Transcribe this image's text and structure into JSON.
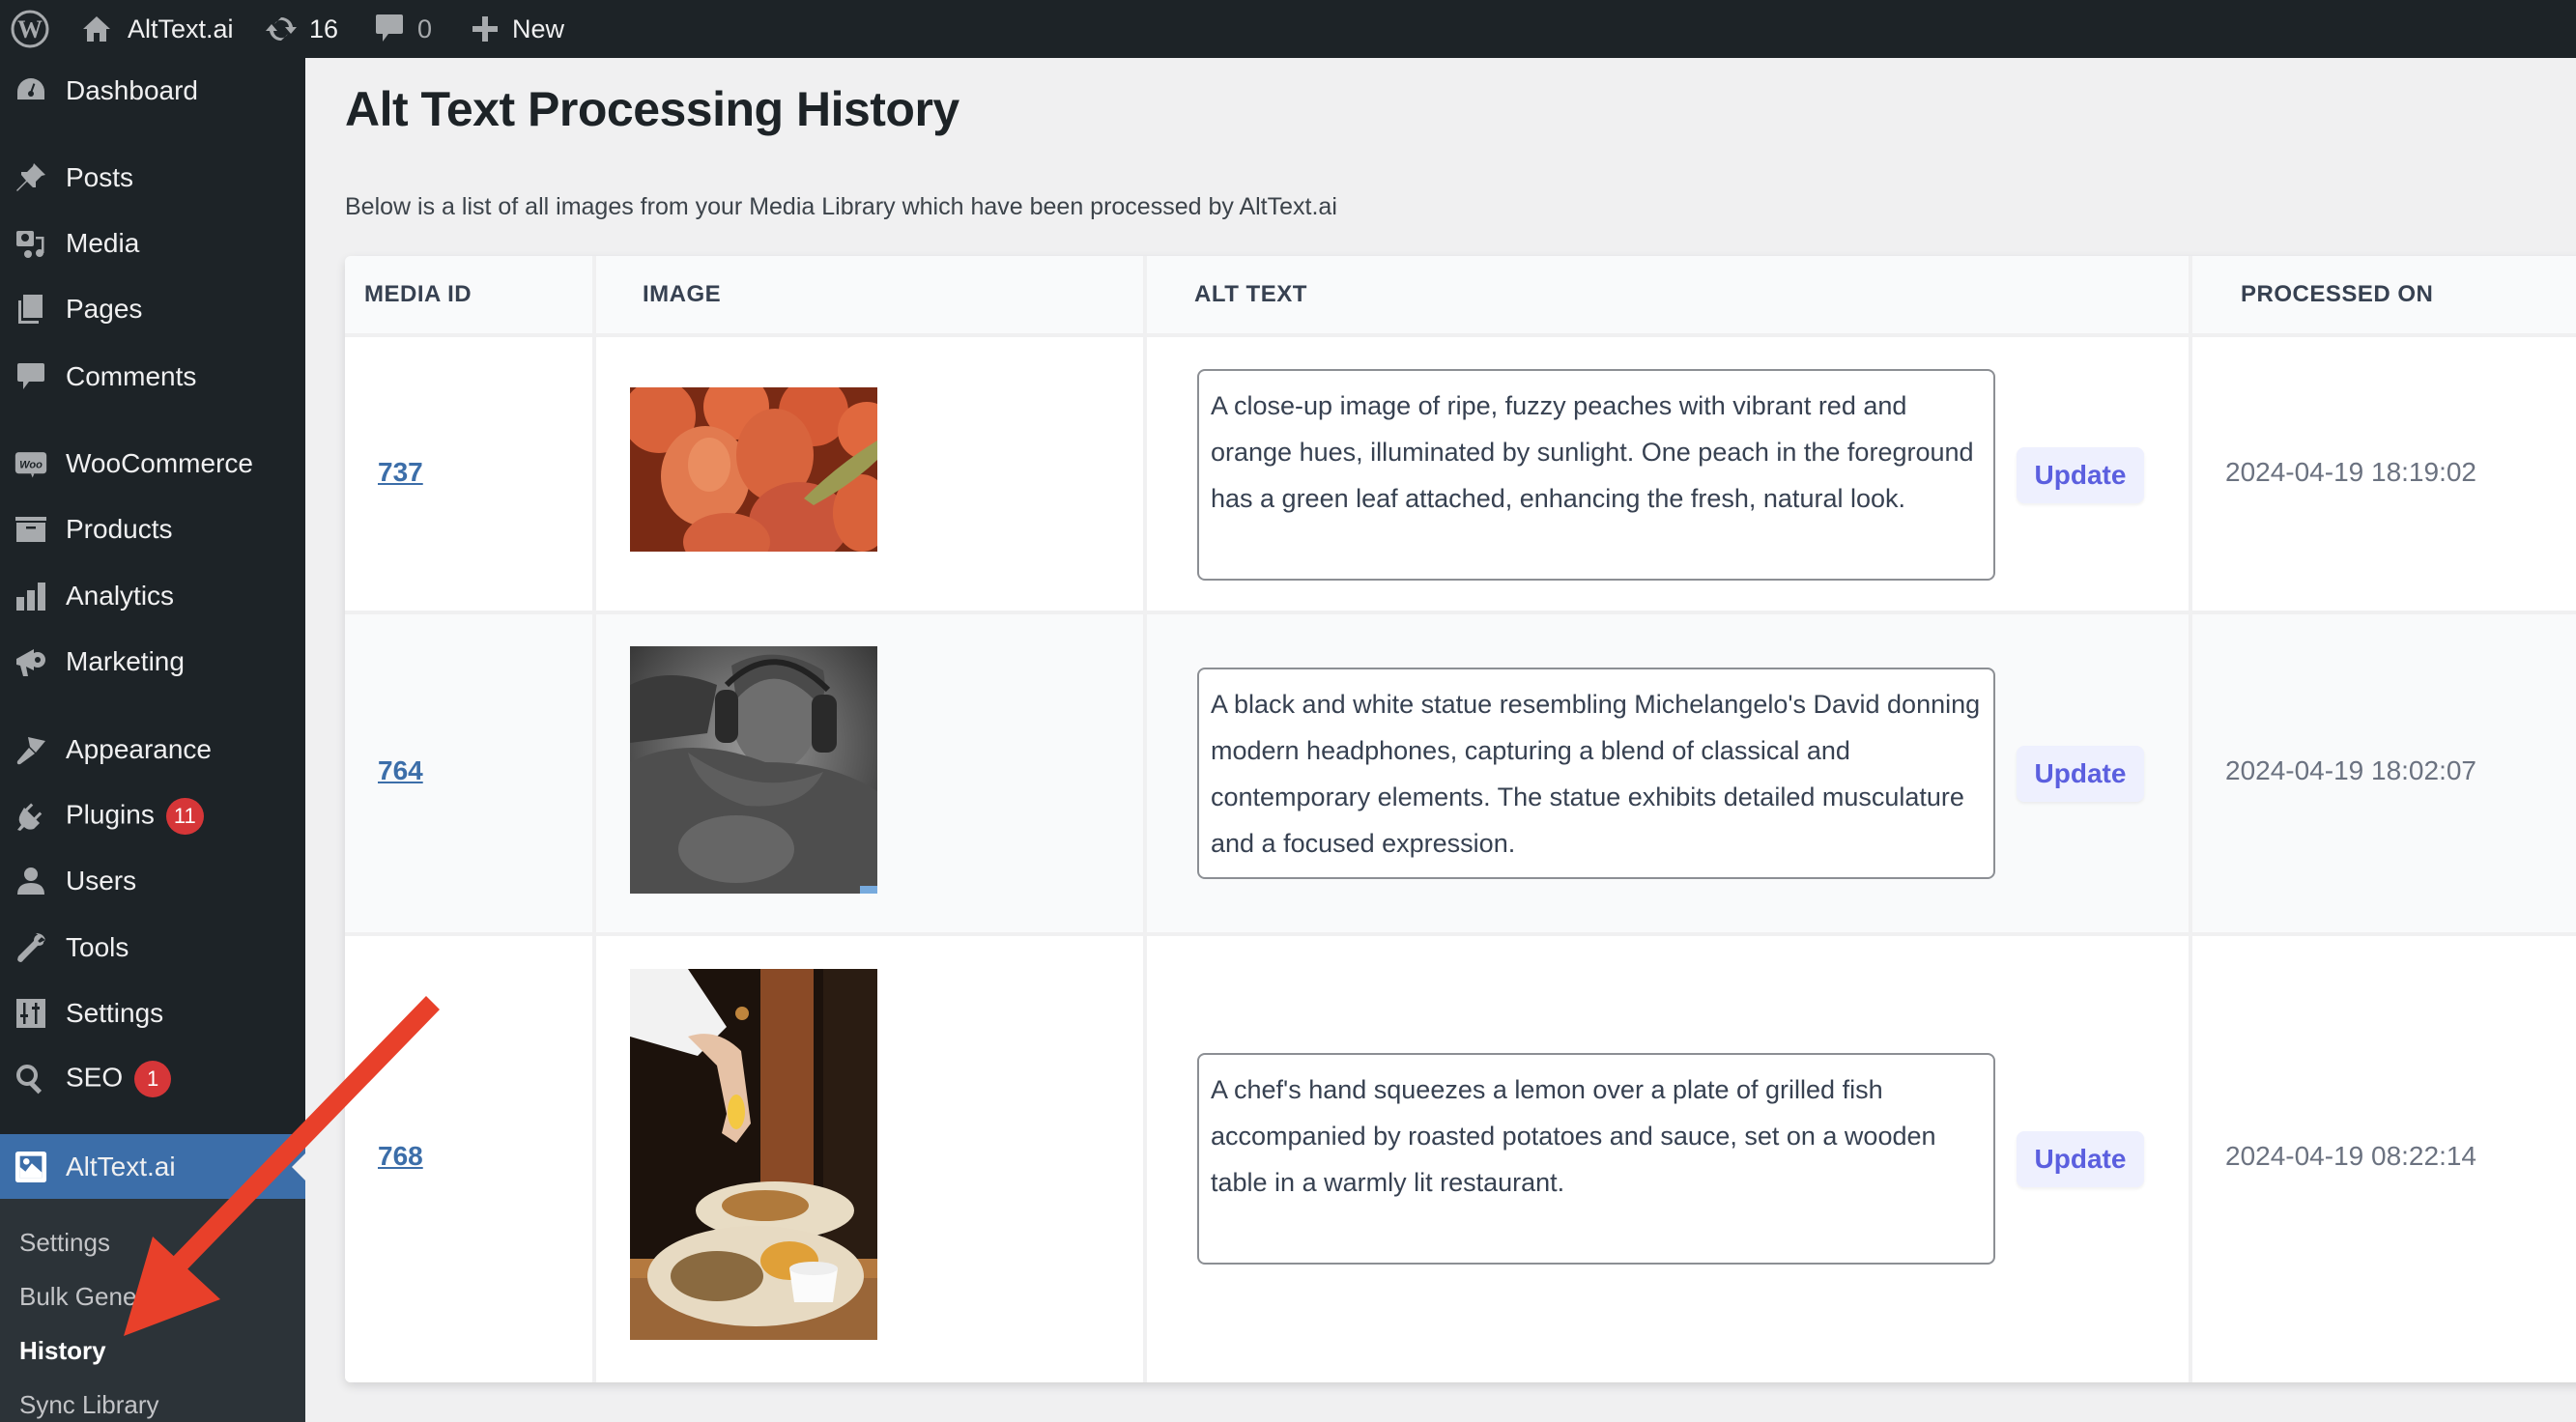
{
  "adminbar": {
    "site_name": "AltText.ai",
    "updates_count": "16",
    "comments_count": "0",
    "new_label": "New"
  },
  "sidebar": {
    "items": [
      {
        "label": "Dashboard",
        "icon": "dashboard-icon"
      },
      {
        "label": "Posts",
        "icon": "pin-icon"
      },
      {
        "label": "Media",
        "icon": "media-icon"
      },
      {
        "label": "Pages",
        "icon": "pages-icon"
      },
      {
        "label": "Comments",
        "icon": "comment-icon"
      },
      {
        "label": "WooCommerce",
        "icon": "woo-icon"
      },
      {
        "label": "Products",
        "icon": "archive-icon"
      },
      {
        "label": "Analytics",
        "icon": "bar-chart-icon"
      },
      {
        "label": "Marketing",
        "icon": "megaphone-icon"
      },
      {
        "label": "Appearance",
        "icon": "paintbrush-icon"
      },
      {
        "label": "Plugins",
        "icon": "plug-icon",
        "badge": "11"
      },
      {
        "label": "Users",
        "icon": "user-icon"
      },
      {
        "label": "Tools",
        "icon": "wrench-icon"
      },
      {
        "label": "Settings",
        "icon": "sliders-icon"
      },
      {
        "label": "SEO",
        "icon": "search-icon",
        "badge": "1"
      },
      {
        "label": "AltText.ai",
        "icon": "alttext-logo-icon"
      }
    ],
    "submenu": [
      {
        "label": "Settings"
      },
      {
        "label": "Bulk Generate"
      },
      {
        "label": "History"
      },
      {
        "label": "Sync Library"
      }
    ]
  },
  "page": {
    "title": "Alt Text Processing History",
    "description": "Below is a list of all images from your Media Library which have been processed by AltText.ai"
  },
  "table": {
    "headers": [
      "MEDIA ID",
      "IMAGE",
      "ALT TEXT",
      "PROCESSED ON"
    ],
    "rows": [
      {
        "media_id": "737",
        "image": "peaches-thumbnail",
        "alt_text": "A close-up image of ripe, fuzzy peaches with vibrant red and orange hues, illuminated by sunlight. One peach in the foreground has a green leaf attached, enhancing the fresh, natural look.",
        "update_label": "Update",
        "processed_on": "2024-04-19 18:19:02"
      },
      {
        "media_id": "764",
        "image": "statue-headphones-thumbnail",
        "alt_text": "A black and white statue resembling Michelangelo's David donning modern headphones, capturing a blend of classical and contemporary elements. The statue exhibits detailed musculature and a focused expression.",
        "update_label": "Update",
        "processed_on": "2024-04-19 18:02:07"
      },
      {
        "media_id": "768",
        "image": "chef-lemon-fish-thumbnail",
        "alt_text": "A chef's hand squeezes a lemon over a plate of grilled fish accompanied by roasted potatoes and sauce, set on a wooden table in a warmly lit restaurant.",
        "update_label": "Update",
        "processed_on": "2024-04-19 08:22:14"
      }
    ]
  },
  "colors": {
    "adminbar_bg": "#1d2327",
    "current_menu_bg": "#3c6ea9",
    "link": "#3c6ea9",
    "update_button_bg": "#eef0fe",
    "update_button_text": "#5b5fdf",
    "badge": "#d63638",
    "annotation_arrow": "#e8402a"
  }
}
